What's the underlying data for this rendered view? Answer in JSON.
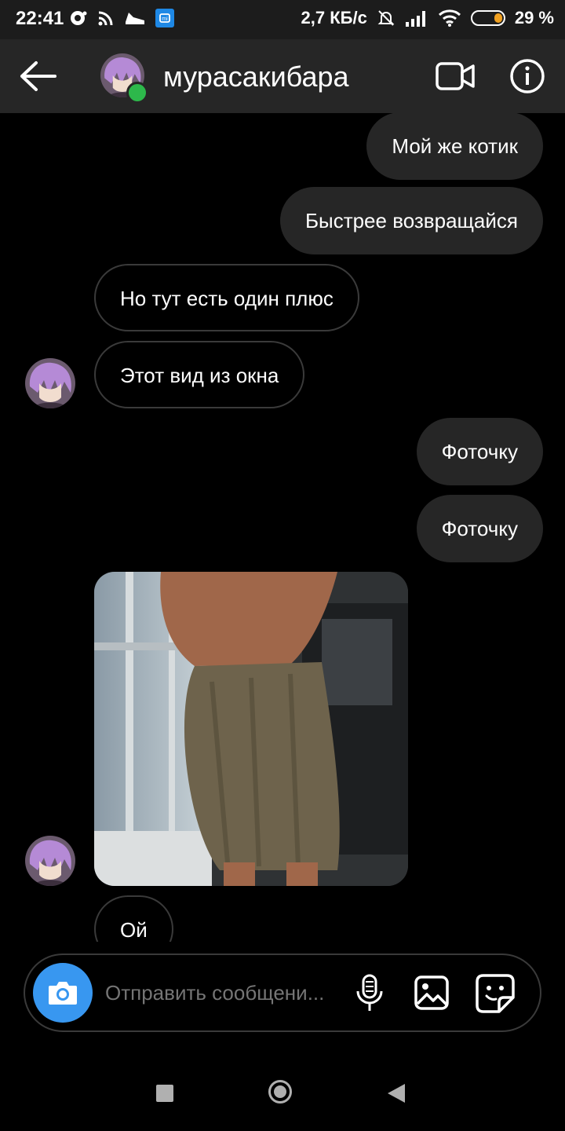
{
  "status_bar": {
    "time": "22:41",
    "network_speed": "2,7 КБ/с",
    "battery_percent": "29 %",
    "battery_level": 0.29,
    "icons": [
      "notification-dot-icon",
      "cast-icon",
      "sneaker-icon",
      "xiaomi-app-icon",
      "mute-bell-icon",
      "signal-icon",
      "wifi-icon",
      "battery-icon"
    ]
  },
  "header": {
    "contact_name": "мурасакибара",
    "online": true,
    "online_color": "#2db84b",
    "icons": [
      "back-arrow-icon",
      "video-call-icon",
      "info-icon"
    ]
  },
  "messages": [
    {
      "type": "outgoing",
      "text": "Мой же котик"
    },
    {
      "type": "outgoing",
      "text": "Быстрее возвращайся"
    },
    {
      "type": "incoming",
      "text": "Но тут есть один плюс"
    },
    {
      "type": "incoming",
      "text": "Этот вид из окна"
    },
    {
      "type": "outgoing",
      "text": "Фоточку"
    },
    {
      "type": "outgoing",
      "text": "Фоточку"
    },
    {
      "type": "incoming",
      "kind": "photo"
    },
    {
      "type": "incoming",
      "text": "Ой"
    }
  ],
  "composer": {
    "placeholder": "Отправить сообщени...",
    "accent_color": "#3897f0",
    "icons": [
      "camera-icon",
      "microphone-icon",
      "gallery-icon",
      "sticker-icon"
    ]
  },
  "nav_bar": {
    "icons": [
      "recent-apps-icon",
      "home-icon",
      "back-icon"
    ]
  }
}
